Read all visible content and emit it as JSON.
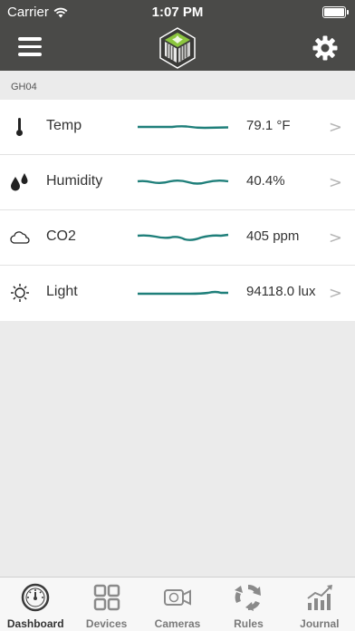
{
  "status_bar": {
    "carrier": "Carrier",
    "time": "1:07 PM"
  },
  "header": {
    "menu_icon": "hamburger-menu-icon",
    "logo_icon": "greenhouse-logo",
    "settings_icon": "gear-icon"
  },
  "section": {
    "label": "GH04"
  },
  "sensors": [
    {
      "label": "Temp",
      "value": "79.1 °F",
      "icon": "thermometer-icon"
    },
    {
      "label": "Humidity",
      "value": "40.4%",
      "icon": "water-drops-icon"
    },
    {
      "label": "CO2",
      "value": "405 ppm",
      "icon": "cloud-icon"
    },
    {
      "label": "Light",
      "value": "94118.0 lux",
      "icon": "sun-icon"
    }
  ],
  "chevron": ">",
  "tabs": [
    {
      "label": "Dashboard",
      "icon": "gauge-icon",
      "active": true
    },
    {
      "label": "Devices",
      "icon": "grid-icon",
      "active": false
    },
    {
      "label": "Cameras",
      "icon": "camera-icon",
      "active": false
    },
    {
      "label": "Rules",
      "icon": "cycle-arrows-icon",
      "active": false
    },
    {
      "label": "Journal",
      "icon": "bar-chart-icon",
      "active": false
    }
  ],
  "colors": {
    "header_bg": "#4a4a48",
    "sparkline": "#1f7f7a",
    "logo_green": "#8cc63f"
  }
}
